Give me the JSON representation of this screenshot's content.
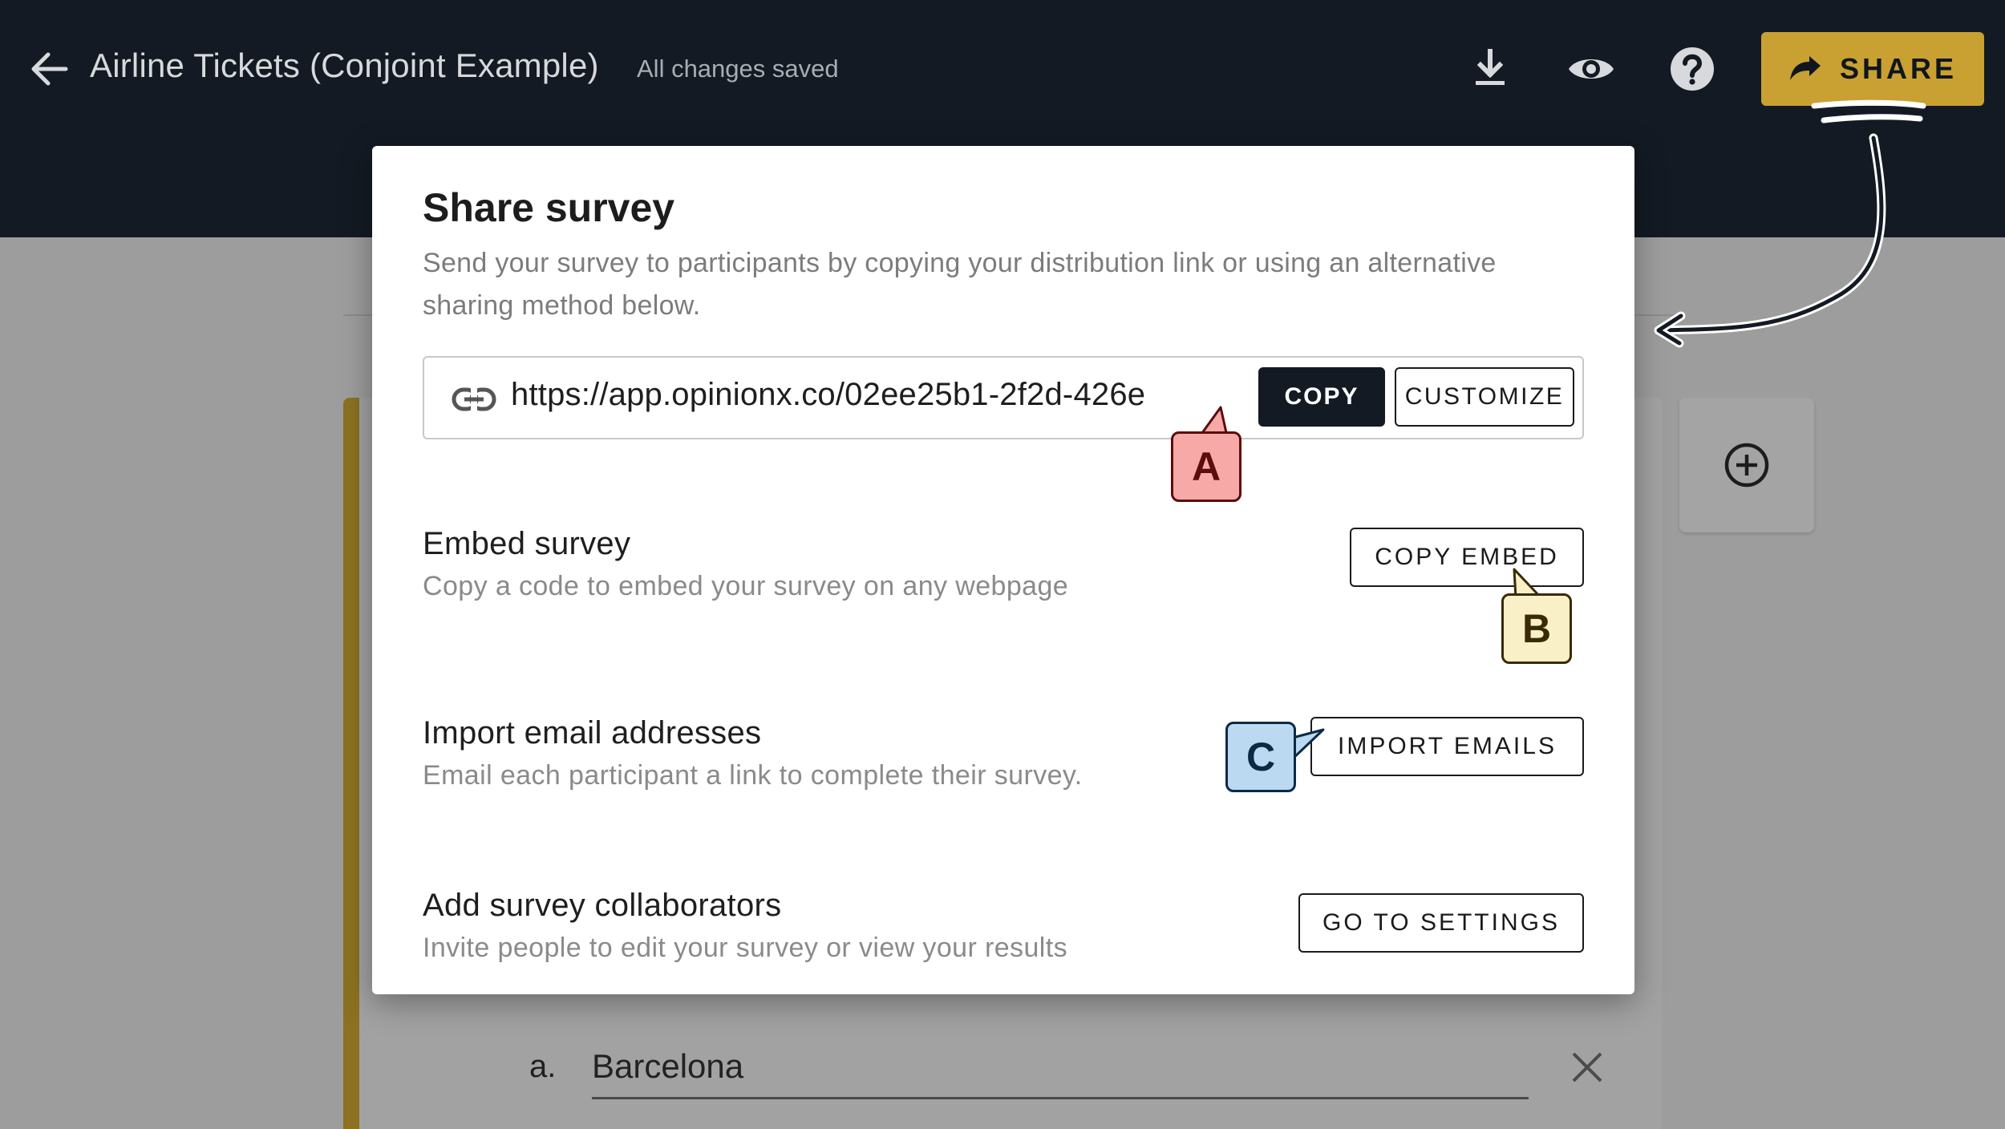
{
  "header": {
    "title": "Airline Tickets (Conjoint Example)",
    "save_status": "All changes saved",
    "share_label": "SHARE"
  },
  "icons": {
    "back": "arrow-left-icon",
    "download": "download-icon",
    "preview": "eye-icon",
    "help": "help-circle-icon",
    "share": "share-arrow-icon",
    "link": "link-icon",
    "add": "add-circle-icon",
    "remove": "close-icon"
  },
  "dialog": {
    "title": "Share survey",
    "description": "Send your survey to participants by copying your distribution link or using an alternative sharing method below.",
    "link_url": "https://app.opinionx.co/02ee25b1-2f2d-426e",
    "copy_label": "COPY",
    "customize_label": "CUSTOMIZE",
    "sections": [
      {
        "title": "Embed survey",
        "subtitle": "Copy a code to embed your survey on any webpage",
        "button": "COPY EMBED"
      },
      {
        "title": "Import email addresses",
        "subtitle": "Email each participant a link to complete their survey.",
        "button": "IMPORT EMAILS"
      },
      {
        "title": "Add survey collaborators",
        "subtitle": "Invite people to edit your survey or view your results",
        "button": "GO TO SETTINGS"
      }
    ]
  },
  "background": {
    "option_letter": "a.",
    "option_value": "Barcelona"
  },
  "annotations": {
    "a": "A",
    "b": "B",
    "c": "C"
  },
  "colors": {
    "topbar": "#131a23",
    "accent": "#c9a032",
    "callout_a": "#f7a9a8",
    "callout_b": "#faf0c8",
    "callout_c": "#bcd9f2"
  }
}
